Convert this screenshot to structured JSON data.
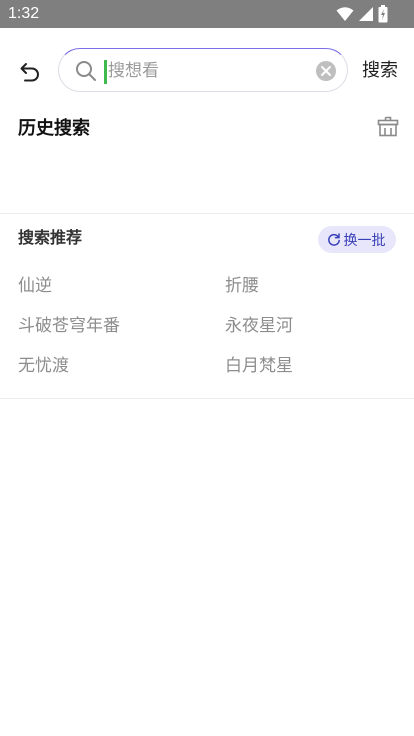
{
  "status_bar": {
    "time": "1:32",
    "icons": [
      "wifi-icon",
      "signal-icon",
      "battery-icon"
    ]
  },
  "search": {
    "placeholder": "搜想看",
    "value": "",
    "submit_label": "搜索"
  },
  "history": {
    "title": "历史搜索",
    "items": []
  },
  "recommend": {
    "title": "搜索推荐",
    "refresh_label": "换一批",
    "items": [
      "仙逆",
      "折腰",
      "斗破苍穹年番",
      "永夜星河",
      "无忧渡",
      "白月梵星"
    ]
  },
  "colors": {
    "status_bar": "#7f7f7f",
    "accent": "#3a40b8",
    "accent_bg": "#e7e6fb",
    "cursor": "#3fba4d",
    "muted_text": "#8d8d8d"
  }
}
